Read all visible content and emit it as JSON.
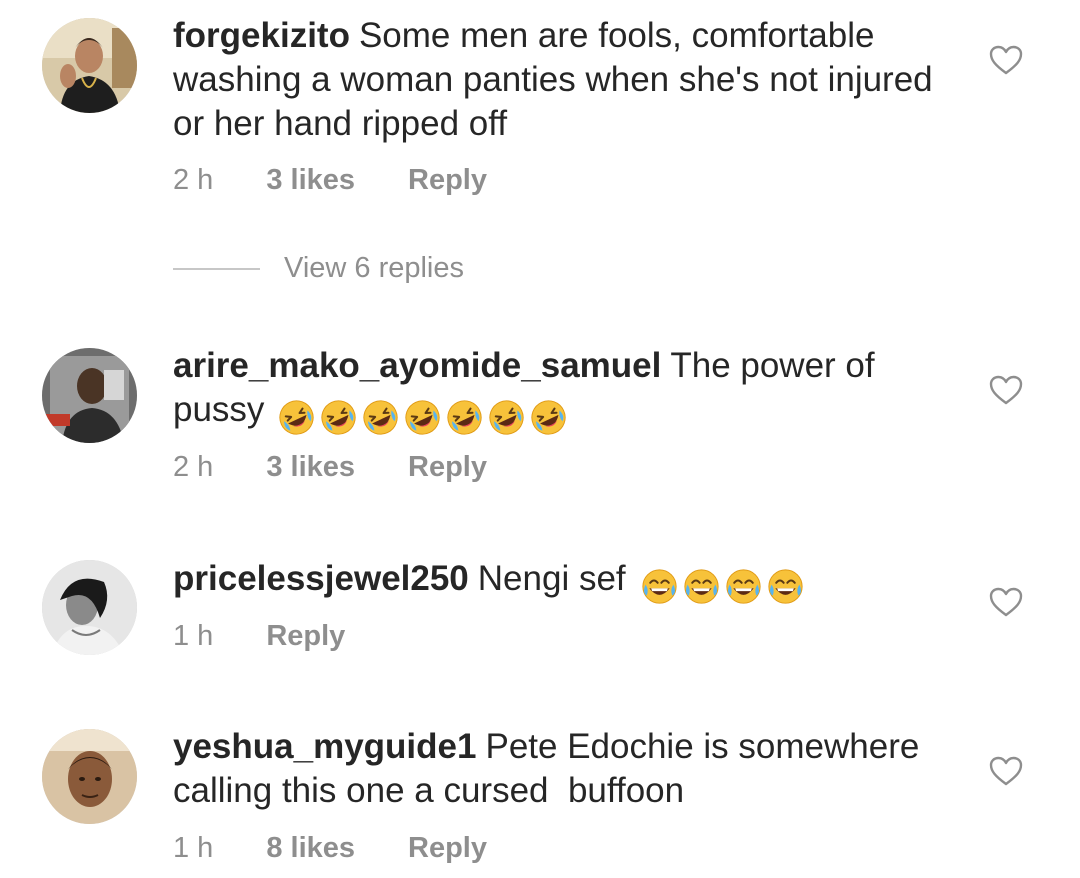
{
  "comments": [
    {
      "username": "forgekizito",
      "text": "Some men are fools, comfortable washing a woman panties when she's not injured or her hand ripped off",
      "time": "2 h",
      "likes": "3 likes",
      "reply": "Reply",
      "view_replies": "View 6 replies",
      "emojis": []
    },
    {
      "username": "arire_mako_ayomide_samuel",
      "text": "The power of pussy",
      "time": "2 h",
      "likes": "3 likes",
      "reply": "Reply",
      "emojis": [
        "rolling-on-floor-laughing",
        "rolling-on-floor-laughing",
        "rolling-on-floor-laughing",
        "rolling-on-floor-laughing",
        "rolling-on-floor-laughing",
        "rolling-on-floor-laughing",
        "rolling-on-floor-laughing"
      ]
    },
    {
      "username": "pricelessjewel250",
      "text": "Nengi sef",
      "time": "1 h",
      "reply": "Reply",
      "emojis": [
        "face-with-tears-of-joy",
        "face-with-tears-of-joy",
        "face-with-tears-of-joy",
        "face-with-tears-of-joy"
      ]
    },
    {
      "username": "yeshua_myguide1",
      "text": "Pete Edochie is somewhere calling this one a cursed  buffoon",
      "time": "1 h",
      "likes": "8 likes",
      "reply": "Reply",
      "emojis": []
    }
  ],
  "icons": {
    "like": "heart-outline-icon",
    "laugh_rolling": "rolling-on-floor-laughing-emoji",
    "laugh_tears": "face-with-tears-of-joy-emoji"
  },
  "colors": {
    "text": "#262626",
    "secondary": "#8e8e8e",
    "divider": "#c7c7c7",
    "background": "#ffffff"
  }
}
